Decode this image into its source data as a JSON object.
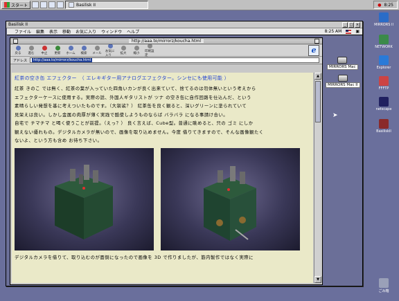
{
  "taskbar": {
    "start_label": "スタート",
    "task_label": "Basilisk II",
    "clock": "8:25"
  },
  "basilisk": {
    "title": "Basilisk II"
  },
  "macmenu": {
    "items": [
      "ファイル",
      "編集",
      "表示",
      "移動",
      "お気に入り",
      "ウィンドウ",
      "ヘルプ"
    ],
    "clock": "8:25 AM"
  },
  "ie": {
    "title": "http://aaa.to/mirrorz/koucha.html",
    "toolbar": [
      {
        "label": "戻る",
        "icon": "back-icon"
      },
      {
        "label": "進む",
        "icon": "forward-icon"
      },
      {
        "label": "中止",
        "icon": "stop-icon"
      },
      {
        "label": "更新",
        "icon": "refresh-icon"
      },
      {
        "label": "ホーム",
        "icon": "home-icon"
      },
      {
        "label": "検索",
        "icon": "search-icon"
      },
      {
        "label": "メール",
        "icon": "mail-icon"
      },
      {
        "label": "お気に入り",
        "icon": "favorites-icon"
      },
      {
        "label": "拡大",
        "icon": "zoom-in-icon"
      },
      {
        "label": "縮小",
        "icon": "zoom-out-icon"
      },
      {
        "label": "印刷設定",
        "icon": "print-icon"
      }
    ],
    "address_label": "アドレス",
    "address_value": "http://aaa.to/mirrorz/koucha.html"
  },
  "page": {
    "heading": "紅茶の空き缶 エフェクター　（ エレキギター用アナログエフェクター。シンセにも使用可能 ）",
    "paragraphs": [
      "紅茶 きのこ では無く、紅茶の葉が入っていた四角いカンが良く出来ていて、捨てるのは勿体無いという考えから",
      "エフェクターケースに使用する。実際の話、外国人ギタリストが ツナ の空き缶に自作回路を仕込んだ、という",
      "素晴らしい発想を基に考えついたものです。（大袈裟？） 紅茶缶を良く観ると、深いグリーンに塗られていて",
      "見栄えは良い。しかし金属の肉厚が薄く実践で酷使しようものならば バラバラ になる事請け合い。",
      "自宅で チマチマ と喝く使うことが前提。（えっ？） 良く言えば、Cube型。普通に眺めると、只の ゴミ にしか",
      "観えない優れもの。デジタルカメラが無いので、画像を取り込めません。今度 借りてきますので、そんな画像観たく",
      "ないよ、という方も含め お待ち下さい。"
    ],
    "caption": "デジタルカメラを借りて、取り込むのが面倒になったので画像を 3D で作りましたが、筋内製作ではなく実際に"
  },
  "mac_desktop": {
    "disks": [
      "MIRRORS Mac",
      "MIRRORS Mac II"
    ]
  },
  "win_desktop": {
    "icons": [
      {
        "label": "MIRRORS II",
        "color": "#2a6cc8",
        "icon": "computer-icon"
      },
      {
        "label": "NETWORK",
        "color": "#3b8a4a",
        "icon": "network-icon"
      },
      {
        "label": "Explorer",
        "color": "#2a7ad8",
        "icon": "ie-icon"
      },
      {
        "label": "FFFTP",
        "color": "#c44",
        "icon": "ftp-icon"
      },
      {
        "label": "netscape",
        "color": "#202060",
        "icon": "netscape-icon"
      },
      {
        "label": "BasiliskII",
        "color": "#8a2a2a",
        "icon": "basilisk-icon"
      }
    ],
    "trash": "ごみ箱"
  }
}
